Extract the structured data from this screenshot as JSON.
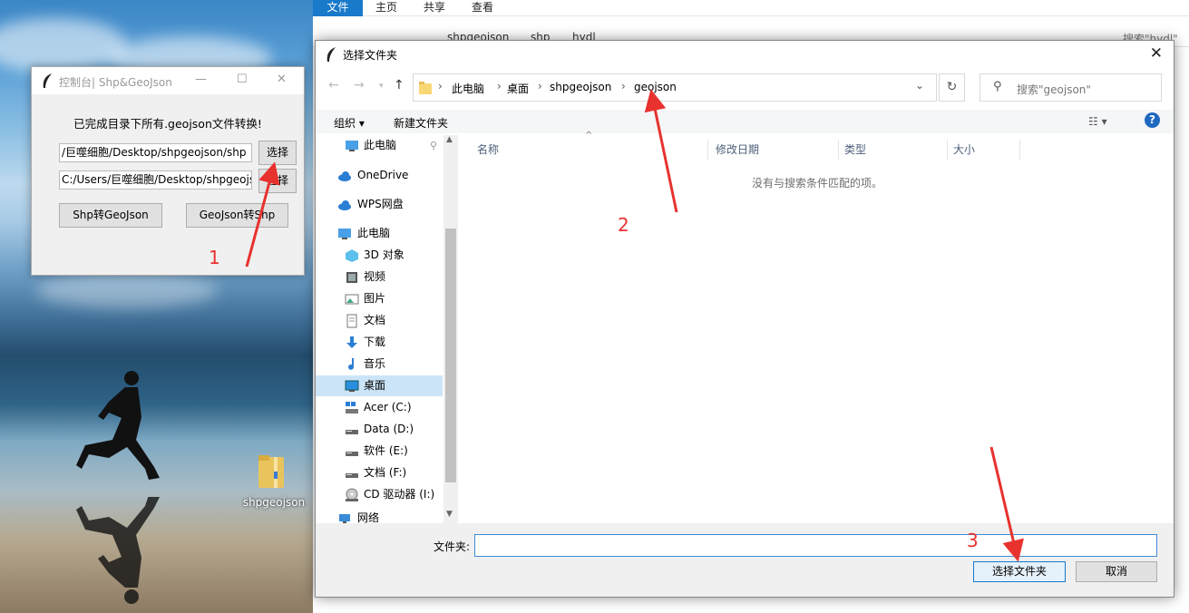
{
  "background_explorer": {
    "ribbon_tabs": [
      "文件",
      "主页",
      "共享",
      "查看"
    ],
    "address_path": [
      "shpgeojson",
      "shp",
      "hydl"
    ],
    "search_placeholder": "搜索\"hydl\""
  },
  "desktop": {
    "icon_label": "shpgeojson"
  },
  "control_window": {
    "title": "控制台| Shp&GeoJson",
    "message": "已完成目录下所有.geojson文件转换!",
    "shp_path": "/巨噬细胞/Desktop/shpgeojson/shp",
    "geojson_path": "C:/Users/巨噬细胞/Desktop/shpgeojson",
    "select_label_1": "选择",
    "select_label_2": "选择",
    "shp_to_geojson_label": "Shp转GeoJson",
    "geojson_to_shp_label": "GeoJson转Shp"
  },
  "annotations": [
    "1",
    "2",
    "3"
  ],
  "dialog": {
    "title": "选择文件夹",
    "breadcrumbs": [
      "此电脑",
      "桌面",
      "shpgeojson",
      "geojson"
    ],
    "search_placeholder": "搜索\"geojson\"",
    "toolbar": {
      "organize": "组织 ▾",
      "new_folder": "新建文件夹"
    },
    "nav_items": [
      {
        "label": "此电脑",
        "icon": "pc-icon"
      },
      {
        "label": "OneDrive",
        "icon": "cloud-icon"
      },
      {
        "label": "WPS网盘",
        "icon": "cloud-icon"
      },
      {
        "label": "此电脑",
        "icon": "pc-icon"
      },
      {
        "label": "3D 对象",
        "icon": "cube-icon"
      },
      {
        "label": "视频",
        "icon": "video-icon"
      },
      {
        "label": "图片",
        "icon": "picture-icon"
      },
      {
        "label": "文档",
        "icon": "document-icon"
      },
      {
        "label": "下载",
        "icon": "download-icon"
      },
      {
        "label": "音乐",
        "icon": "music-icon"
      },
      {
        "label": "桌面",
        "icon": "desktop-icon",
        "selected": true
      },
      {
        "label": "Acer (C:)",
        "icon": "windows-drive-icon"
      },
      {
        "label": "Data (D:)",
        "icon": "drive-icon"
      },
      {
        "label": "软件 (E:)",
        "icon": "drive-icon"
      },
      {
        "label": "文档 (F:)",
        "icon": "drive-icon"
      },
      {
        "label": "CD 驱动器 (I:)",
        "icon": "cd-drive-icon"
      },
      {
        "label": "网络",
        "icon": "network-icon"
      }
    ],
    "columns": [
      "名称",
      "修改日期",
      "类型",
      "大小"
    ],
    "empty_message": "没有与搜索条件匹配的项。",
    "folder_label": "文件夹:",
    "folder_value": "",
    "select_folder_button": "选择文件夹",
    "cancel_button": "取消"
  },
  "colors": {
    "accent": "#1979ca",
    "annotation": "#e8322e",
    "selected_bg": "#cce4f7"
  }
}
